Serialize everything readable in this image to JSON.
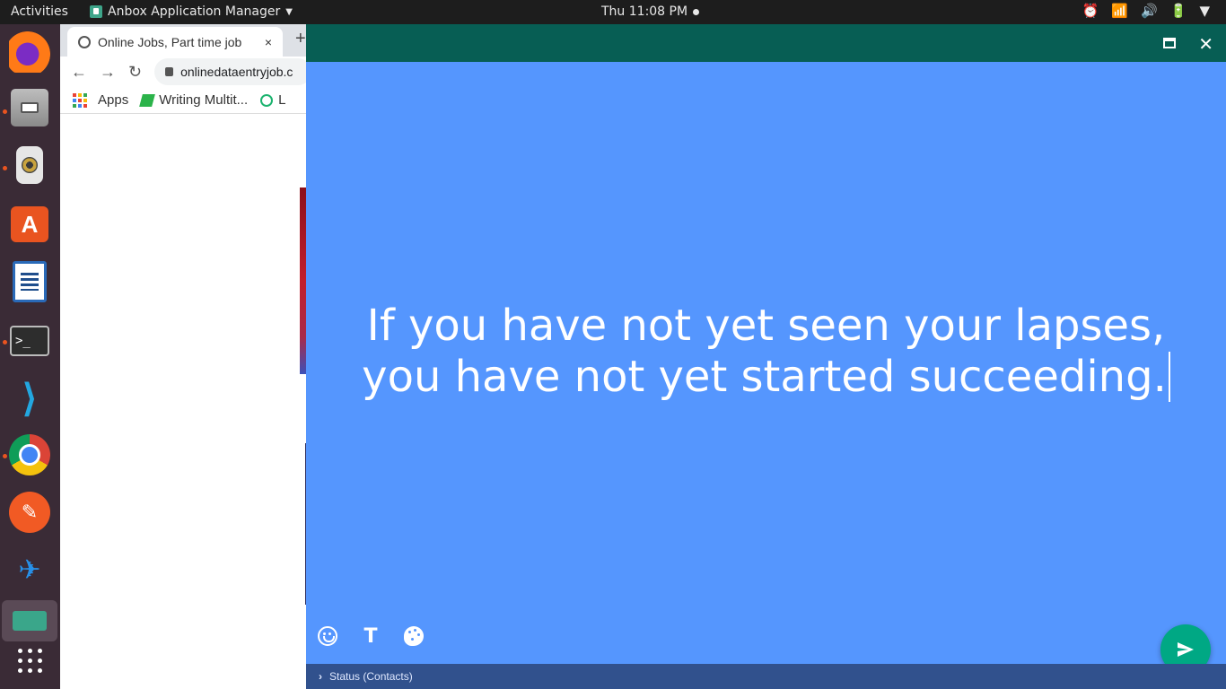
{
  "topbar": {
    "activities": "Activities",
    "app_menu": "Anbox Application Manager",
    "clock": "Thu 11:08 PM"
  },
  "dock": {
    "items": [
      "firefox-icon",
      "files-icon",
      "rhythmbox-icon",
      "software-center-icon",
      "libreoffice-writer-icon",
      "terminal-icon",
      "vscode-icon",
      "chrome-icon",
      "postman-icon",
      "bird-icon",
      "anbox-icon",
      "show-apps-icon"
    ]
  },
  "browser": {
    "tab_title": "Online Jobs, Part time job",
    "tab_close": "×",
    "new_tab": "+",
    "url": "onlinedataentryjob.c",
    "bookmarks": {
      "apps": "Apps",
      "writing": "Writing Multit...",
      "third": "L"
    }
  },
  "anbox": {
    "accent": "#075e54",
    "background": "#5596fe",
    "status_text": "If you have not yet seen your lapses, you have not yet started succeeding.",
    "text_tool": "T",
    "status_bar_label": "Status (Contacts)",
    "send_color": "#00a884"
  }
}
